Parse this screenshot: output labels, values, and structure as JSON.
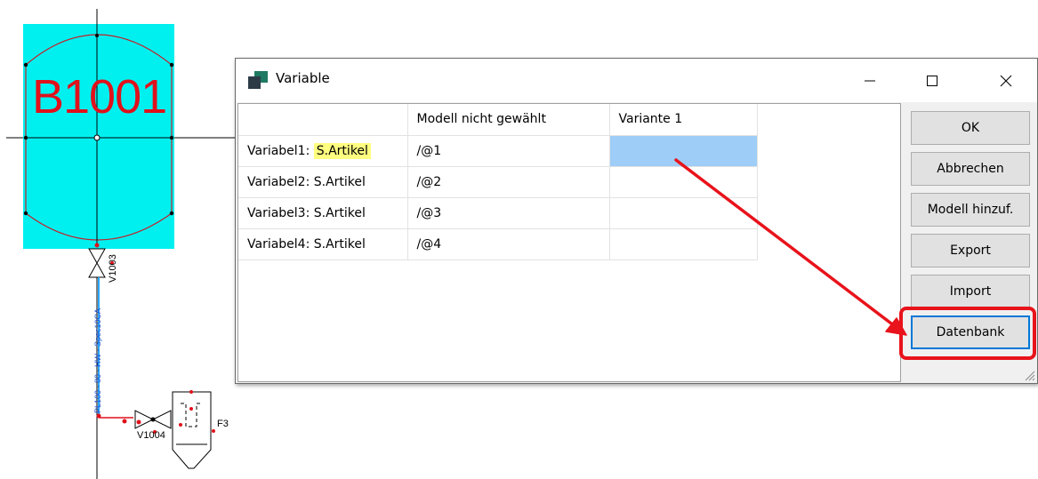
{
  "drawing": {
    "tank_label": "B1001",
    "pipe_label": "PL100 - 80 - HW - Spec10CA",
    "valve_label_1": "V1003",
    "valve_label_2": "V1004",
    "equipment_label": "F3"
  },
  "dialog": {
    "title": "Variable",
    "icon": "app-window-icon",
    "window_controls": {
      "minimize": "—",
      "maximize": "☐",
      "close": "✕"
    },
    "table": {
      "columns": [
        "",
        "Modell nicht gewählt",
        "Variante 1"
      ],
      "rows": [
        {
          "name_prefix": "Variabel1: ",
          "name_highlight": "S.Artikel",
          "value": "/@1",
          "variant": ""
        },
        {
          "name": "Variabel2: S.Artikel",
          "value": "/@2",
          "variant": ""
        },
        {
          "name": "Variabel3: S.Artikel",
          "value": "/@3",
          "variant": ""
        },
        {
          "name": "Variabel4: S.Artikel",
          "value": "/@4",
          "variant": ""
        }
      ]
    },
    "buttons": {
      "ok": "OK",
      "cancel": "Abbrechen",
      "add_model": "Modell hinzuf.",
      "export": "Export",
      "import": "Import",
      "database": "Datenbank"
    }
  },
  "colors": {
    "tank_fill": "#00f0f0",
    "tank_outline": "#c0232b",
    "annotation_red": "#e8131b",
    "selection_blue": "#9ecdf7",
    "highlight_yellow": "#ffff80"
  }
}
